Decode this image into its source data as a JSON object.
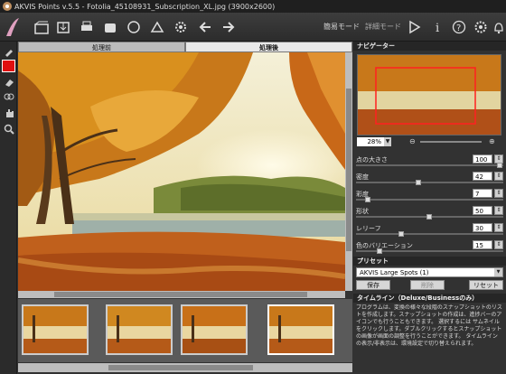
{
  "titlebar": {
    "text": "AKVIS Points v.5.5 - Fotolia_45108931_Subscription_XL.jpg (3900x2600)"
  },
  "toolbar": {
    "express_mode": "簡易モード",
    "advanced_mode": "詳細モード",
    "icons": [
      "open-icon",
      "save-icon",
      "print-icon",
      "share-icon",
      "batch-icon",
      "presets-icon",
      "settings-icon",
      "undo-icon",
      "redo-icon",
      "run-icon",
      "info-icon",
      "help-icon",
      "preferences-icon",
      "bell-icon"
    ]
  },
  "view_tabs": {
    "before": "処理前",
    "after": "処理後"
  },
  "navigator": {
    "title": "ナビゲーター",
    "zoom": "28%"
  },
  "params": [
    {
      "label": "点の大きさ",
      "value": "100",
      "level": 1.0
    },
    {
      "label": "密度",
      "value": "42",
      "level": 0.42
    },
    {
      "label": "彩度",
      "value": "7",
      "level": 0.07
    },
    {
      "label": "形状",
      "value": "50",
      "level": 0.5
    },
    {
      "label": "レリーフ",
      "value": "30",
      "level": 0.3
    },
    {
      "label": "色のバリエーション",
      "value": "15",
      "level": 0.15
    }
  ],
  "presets": {
    "title": "プリセット",
    "selected": "AKVIS Large Spots (1)",
    "save": "保存",
    "delete": "削除",
    "reset": "リセット"
  },
  "timeline": {
    "title": "タイムライン（Deluxe/Businessのみ）",
    "text": "プログラムは、変換の様々な段階のスナップショットのリストを作成します。スナップショットの作成は、進捗バーのアイコンでも行うこともできます。",
    "text2": "選択するには サムネイルをクリックします。ダブルクリックするとスナップショットの画像が画面の調整を行うことができます。",
    "text3": "タイムライン の表示/非表示は、環境設定で切り替えられます。"
  },
  "colors": {
    "accent_red": "#e01010"
  }
}
